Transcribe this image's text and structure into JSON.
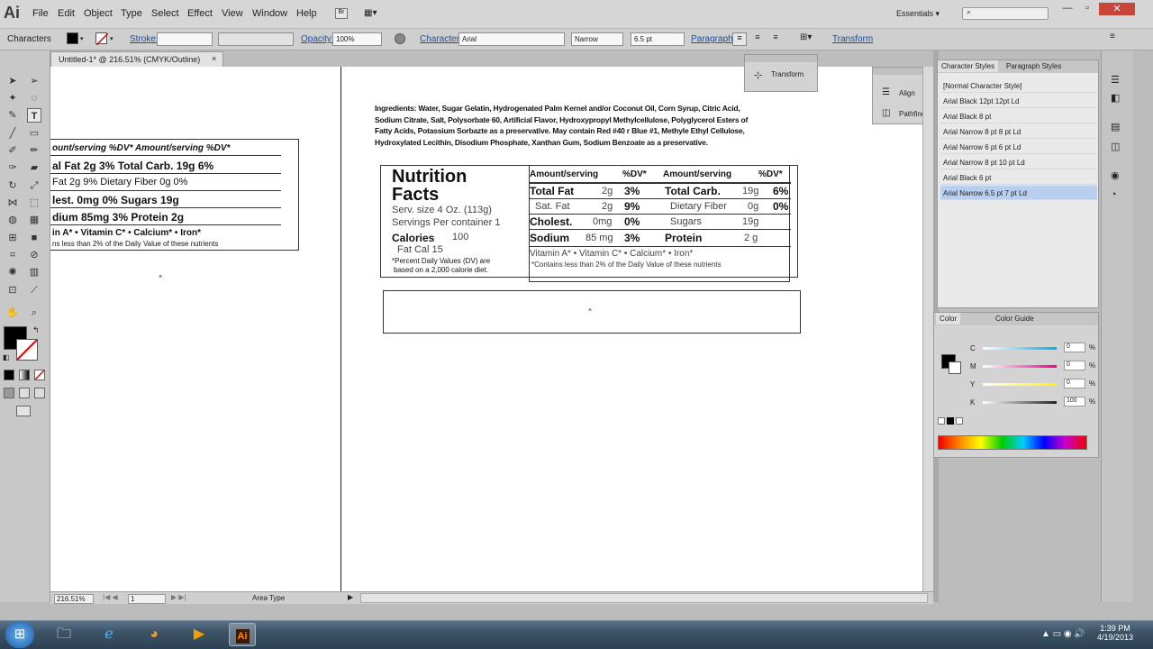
{
  "app": {
    "logo": "Ai",
    "workspace": "Essentials"
  },
  "menu": [
    "File",
    "Edit",
    "Object",
    "Type",
    "Select",
    "Effect",
    "View",
    "Window",
    "Help"
  ],
  "control": {
    "tool_label": "Characters",
    "stroke_label": "Stroke:",
    "opacity_label": "Opacity:",
    "opacity_value": "100%",
    "character_label": "Character:",
    "font_family": "Arial",
    "font_style": "Narrow",
    "font_size": "6.5 pt",
    "paragraph_label": "Paragraph:",
    "transform_label": "Transform"
  },
  "document": {
    "tab_title": "Untitled-1* @ 216.51% (CMYK/Outline)"
  },
  "artboard": {
    "ingredients": [
      "Ingredients: Water, Sugar Gelatin, Hydrogenated Palm Kernel and/or Coconut Oil, Corn Syrup, Citric Acid,",
      "Sodium Citrate, Salt, Polysorbate 60, Artificial Flavor, Hydroxypropyl Methylcellulose, Polyglycerol Esters of",
      "Fatty Acids, Potassium Sorbazte as a preservative. May contain Red #40 r Blue #1, Methyle Ethyl Cellulose,",
      "Hydroxylated Lecithin, Disodium Phosphate, Xanthan Gum, Sodium Benzoate as a preservative."
    ],
    "title_line1": "Nutrition",
    "title_line2": "Facts",
    "serv_size": "Serv. size 4 Oz. (113g)",
    "servings": "Servings Per container 1",
    "calories_label": "Calories",
    "calories_value": "100",
    "fat_cal": "Fat Cal 15",
    "dv_note_1": "*Percent Daily Values (DV) are",
    "dv_note_2": "based on a 2,000 calorie diet.",
    "header": {
      "amount": "Amount/serving",
      "dv": "%DV*",
      "amount2": "Amount/serving",
      "dv2": "%DV*"
    },
    "rows": [
      {
        "l_label": "Total Fat",
        "l_amt": "2g",
        "l_dv": "3%",
        "r_label": "Total Carb.",
        "r_amt": "19g",
        "r_dv": "6%"
      },
      {
        "l_label": "Sat. Fat",
        "l_amt": "2g",
        "l_dv": "9%",
        "r_label": "Dietary Fiber",
        "r_amt": "0g",
        "r_dv": "0%"
      },
      {
        "l_label": "Cholest.",
        "l_amt": "0mg",
        "l_dv": "0%",
        "r_label": "Sugars",
        "r_amt": "19g",
        "r_dv": ""
      },
      {
        "l_label": "Sodium",
        "l_amt": "85 mg",
        "l_dv": "3%",
        "r_label": "Protein",
        "r_amt": "2 g",
        "r_dv": ""
      }
    ],
    "vitamins": "Vitamin  A*   •   Vitamin   C*   •   Calcium*   •   Iron*",
    "contains_note": "*Contains less than 2% of the Daily Value of these nutrients",
    "left_fragment": {
      "header": "ount/serving    %DV*  Amount/serving    %DV*",
      "rows": [
        "al Fat    2g    3%   Total Carb. 19g   6%",
        "Fat       2g    9%     Dietary Fiber   0g    0%",
        "lest.  0mg   0%      Sugars          19g",
        "dium  85mg   3%    Protein          2g"
      ],
      "vitamins": "in A*   •   Vitamin C*   •   Calcium*   •   Iron*",
      "note": "ns less than 2% of the Daily Value of these nutrients"
    }
  },
  "panels": {
    "transform": "Transform",
    "align": "Align",
    "pathfinder": "Pathfinder",
    "char_styles_tab": "Character Styles",
    "para_styles_tab": "Paragraph Styles",
    "styles": [
      "[Normal Character Style]",
      "Arial Black 12pt 12pt Ld",
      "Arial Black 8 pt",
      "Arial Narrow 8 pt 8 pt Ld",
      "Arial Narrow 6 pt 6 pt Ld",
      "Arial Narrow 8 pt 10 pt Ld",
      "Arial Black 6 pt",
      "Arial Narrow 6.5 pt 7 pt Ld"
    ],
    "color_tab": "Color",
    "color_guide_tab": "Color Guide",
    "cmyk": [
      {
        "label": "C",
        "value": "0"
      },
      {
        "label": "M",
        "value": "0"
      },
      {
        "label": "Y",
        "value": "0"
      },
      {
        "label": "K",
        "value": "100"
      }
    ],
    "pct": "%"
  },
  "status": {
    "zoom": "216.51%",
    "page": "1",
    "mode": "Area Type"
  },
  "taskbar": {
    "time": "1:39 PM",
    "date": "4/19/2013"
  }
}
